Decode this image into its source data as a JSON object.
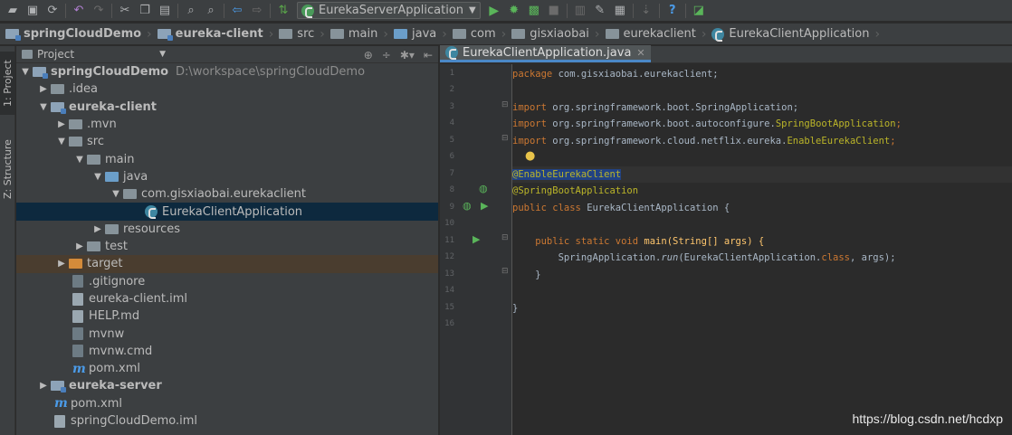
{
  "toolbar": {
    "run_config": "EurekaServerApplication",
    "icons": [
      "open-folder-icon",
      "save-icon",
      "sync-icon",
      "undo-icon",
      "redo-icon",
      "cut-icon",
      "copy-icon",
      "paste-icon",
      "find-icon",
      "replace-icon",
      "back-icon",
      "forward-icon",
      "build-icon",
      "run-config-icon",
      "dropdown-icon",
      "run-icon",
      "debug-icon",
      "coverage-icon",
      "stop-icon",
      "project-structure-icon",
      "settings-icon",
      "sdk-icon",
      "vcs-icon",
      "help-icon",
      "terminal-icon"
    ]
  },
  "breadcrumb": [
    "springCloudDemo",
    "eureka-client",
    "src",
    "main",
    "java",
    "com",
    "gisxiaobai",
    "eurekaclient",
    "EurekaClientApplication"
  ],
  "sidebar": {
    "project_tab": "1: Project",
    "structure_tab": "Z: Structure"
  },
  "project_panel": {
    "title": "Project",
    "tree": [
      {
        "label": "springCloudDemo",
        "path": "D:\\workspace\\springCloudDemo",
        "bold": true
      },
      {
        "label": ".idea"
      },
      {
        "label": "eureka-client",
        "bold": true
      },
      {
        "label": ".mvn"
      },
      {
        "label": "src"
      },
      {
        "label": "main"
      },
      {
        "label": "java"
      },
      {
        "label": "com.gisxiaobai.eurekaclient"
      },
      {
        "label": "EurekaClientApplication"
      },
      {
        "label": "resources"
      },
      {
        "label": "test"
      },
      {
        "label": "target"
      },
      {
        "label": ".gitignore"
      },
      {
        "label": "eureka-client.iml"
      },
      {
        "label": "HELP.md"
      },
      {
        "label": "mvnw"
      },
      {
        "label": "mvnw.cmd"
      },
      {
        "label": "pom.xml"
      },
      {
        "label": "eureka-server",
        "bold": true
      },
      {
        "label": "pom.xml"
      },
      {
        "label": "springCloudDemo.iml"
      }
    ]
  },
  "editor": {
    "tab_label": "EurekaClientApplication.java",
    "line_numbers": [
      "1",
      "2",
      "3",
      "4",
      "5",
      "6",
      "7",
      "8",
      "9",
      "10",
      "11",
      "12",
      "13",
      "14",
      "15",
      "16"
    ],
    "code": {
      "l1_kw": "package ",
      "l1_rest": "com.gisxiaobai.eurekaclient;",
      "l3_kw": "import ",
      "l3_rest": "org.springframework.boot.SpringApplication;",
      "l4_kw": "import ",
      "l4_a": "org.springframework.boot.autoconfigure.",
      "l4_b": "SpringBootApplication",
      "l4_c": ";",
      "l5_kw": "import ",
      "l5_a": "org.springframework.cloud.netflix.eureka.",
      "l5_b": "EnableEurekaClient",
      "l5_c": ";",
      "l7": "@EnableEurekaClient",
      "l8": "@SpringBootApplication",
      "l9_kw": "public class ",
      "l9_rest": "EurekaClientApplication {",
      "l11_kw": "    public static void ",
      "l11_rest": "main(String[] args) {",
      "l12_a": "        SpringApplication.",
      "l12_b": "run",
      "l12_c": "(EurekaClientApplication.",
      "l12_d": "class",
      "l12_e": ", args);",
      "l13": "    }",
      "l15": "}"
    }
  },
  "watermark": "https://blog.csdn.net/hcdxp"
}
